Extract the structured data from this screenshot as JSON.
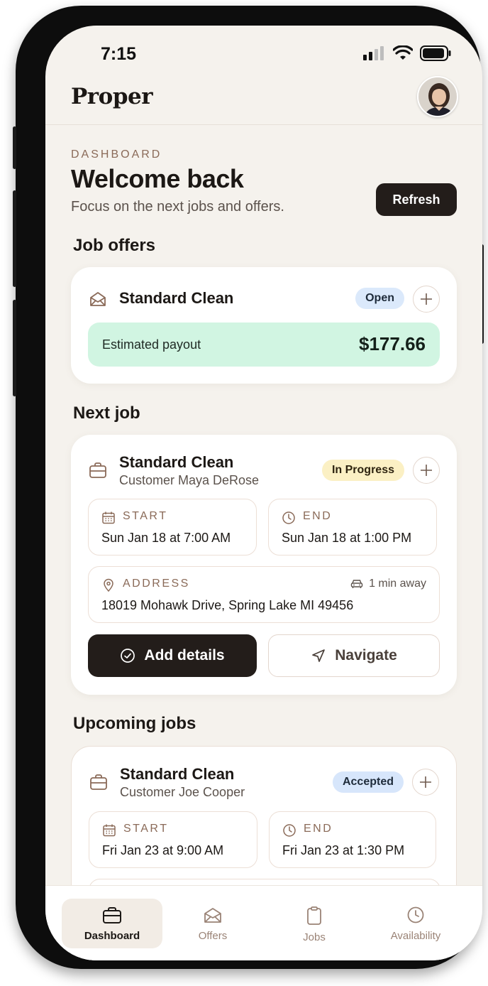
{
  "status_bar": {
    "time": "7:15"
  },
  "header": {
    "brand": "Proper"
  },
  "dashboard": {
    "eyebrow": "DASHBOARD",
    "title": "Welcome back",
    "subtitle": "Focus on the next jobs and offers.",
    "refresh_label": "Refresh"
  },
  "job_offers": {
    "section_title": "Job offers",
    "offer": {
      "title": "Standard Clean",
      "status": "Open",
      "payout_label": "Estimated payout",
      "payout_value": "$177.66"
    }
  },
  "next_job": {
    "section_title": "Next job",
    "title": "Standard Clean",
    "customer": "Customer Maya DeRose",
    "status": "In Progress",
    "start_label": "START",
    "start_value": "Sun Jan 18 at 7:00 AM",
    "end_label": "END",
    "end_value": "Sun Jan 18 at 1:00 PM",
    "address_label": "ADDRESS",
    "address_value": "18019 Mohawk Drive, Spring Lake MI 49456",
    "travel_time": "1 min away",
    "add_details_label": "Add details",
    "navigate_label": "Navigate"
  },
  "upcoming_jobs": {
    "section_title": "Upcoming jobs",
    "items": [
      {
        "title": "Standard Clean",
        "customer": "Customer Joe Cooper",
        "status": "Accepted",
        "start_label": "START",
        "start_value": "Fri Jan 23 at 9:00 AM",
        "end_label": "END",
        "end_value": "Fri Jan 23 at 1:30 PM"
      }
    ]
  },
  "tabbar": {
    "items": [
      {
        "label": "Dashboard",
        "icon": "briefcase-icon",
        "active": true
      },
      {
        "label": "Offers",
        "icon": "envelope-icon",
        "active": false
      },
      {
        "label": "Jobs",
        "icon": "clipboard-icon",
        "active": false
      },
      {
        "label": "Availability",
        "icon": "clock-icon",
        "active": false
      }
    ]
  },
  "colors": {
    "background": "#f5f2ed",
    "primary_dark": "#231d1a",
    "accent_brown": "#8a6a58",
    "payout_green": "#d1f5e2",
    "badge_open": "#dbe9fb",
    "badge_in_progress": "#fbf0c4",
    "badge_accepted": "#d7e6fb"
  }
}
